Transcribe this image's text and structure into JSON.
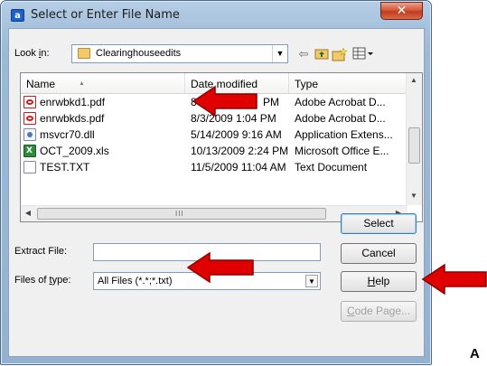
{
  "window": {
    "title": "Select or Enter File Name",
    "close_glyph": "✕"
  },
  "lookin": {
    "label_prefix": "Look ",
    "label_underline": "i",
    "label_suffix": "n:",
    "folder": "Clearinghouseedits"
  },
  "toolbar_icons": [
    "back-icon",
    "up-folder-icon",
    "new-folder-icon",
    "view-menu-icon"
  ],
  "filelist": {
    "columns": [
      "Name",
      "Date modified",
      "Type"
    ],
    "rows": [
      {
        "icon": "pdf",
        "name": "enrwbkd1.pdf",
        "date": "8",
        "date2": "PM",
        "type": "Adobe Acrobat D..."
      },
      {
        "icon": "pdf",
        "name": "enrwbkds.pdf",
        "date": "8/3/2009 1:04 PM",
        "type": "Adobe Acrobat D..."
      },
      {
        "icon": "dll",
        "name": "msvcr70.dll",
        "date": "5/14/2009 9:16 AM",
        "type": "Application Extens..."
      },
      {
        "icon": "xls",
        "name": "OCT_2009.xls",
        "date": "10/13/2009 2:24 PM",
        "type": "Microsoft Office E..."
      },
      {
        "icon": "txt",
        "name": "TEST.TXT",
        "date": "11/5/2009 11:04 AM",
        "type": "Text Document"
      }
    ],
    "hscroll_grip": "III"
  },
  "extract": {
    "label": "Extract File:",
    "value": ""
  },
  "filetype": {
    "label_prefix": "Files of ",
    "label_underline": "t",
    "label_suffix": "ype:",
    "value": "All Files (*.*;*.txt)"
  },
  "buttons": {
    "select": "Select",
    "cancel": "Cancel",
    "help_underline": "H",
    "help_rest": "elp",
    "codepage_underline": "C",
    "codepage_rest": "ode Page..."
  },
  "annotation": {
    "letter": "A",
    "arrow_color": "#e00000"
  }
}
